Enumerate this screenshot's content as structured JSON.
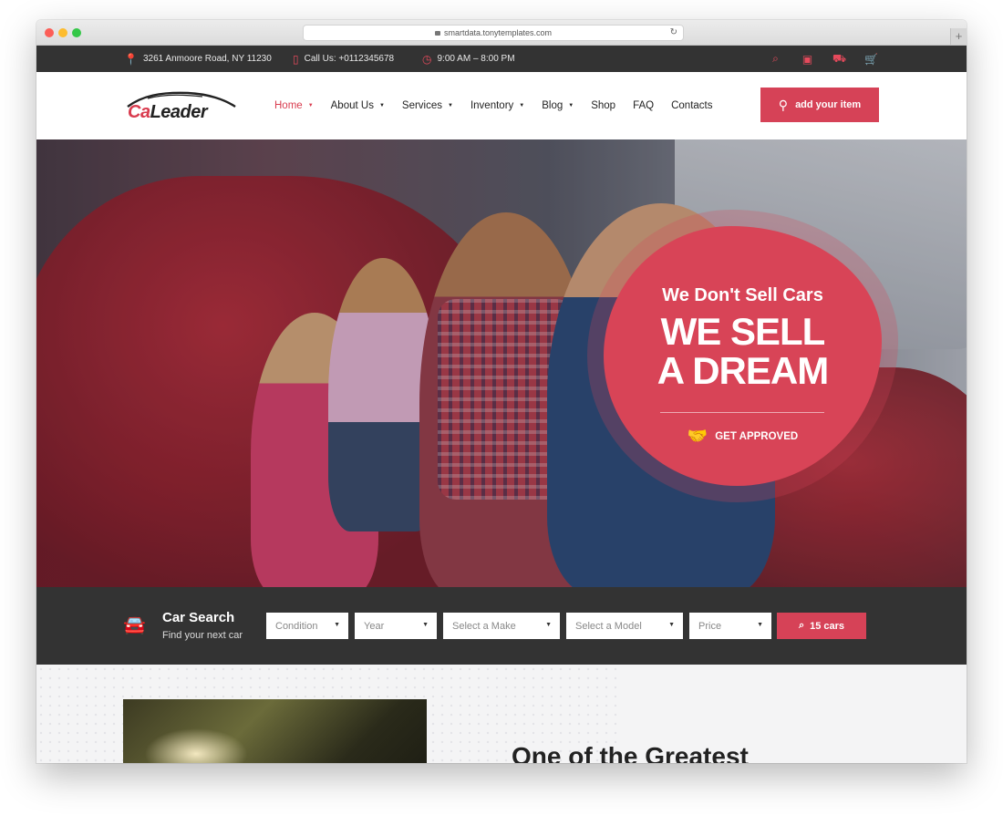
{
  "browser": {
    "url": "smartdata.tonytemplates.com",
    "newtab_symbol": "+"
  },
  "topbar": {
    "address": "3261 Anmoore Road, NY 11230",
    "phone": "Call Us: +0112345678",
    "hours": "9:00 AM – 8:00 PM",
    "icons": [
      "search-icon",
      "user-icon",
      "car-icon",
      "cart-icon"
    ]
  },
  "brand": {
    "logo_prefix": "Ca",
    "logo_suffix": "Leader",
    "accent": "#d64257"
  },
  "nav": {
    "items": [
      {
        "label": "Home",
        "dropdown": true,
        "active": true
      },
      {
        "label": "About Us",
        "dropdown": true
      },
      {
        "label": "Services",
        "dropdown": true
      },
      {
        "label": "Inventory",
        "dropdown": true
      },
      {
        "label": "Blog",
        "dropdown": true
      },
      {
        "label": "Shop",
        "dropdown": false
      },
      {
        "label": "FAQ",
        "dropdown": false
      },
      {
        "label": "Contacts",
        "dropdown": false
      }
    ],
    "cta_label": "add your item"
  },
  "hero": {
    "tagline": "We Don't Sell Cars",
    "headline_line1": "WE SELL",
    "headline_line2": "A DREAM",
    "cta_label": "GET APPROVED"
  },
  "search": {
    "title": "Car Search",
    "subtitle": "Find your next car",
    "filters": {
      "condition": "Condition",
      "year": "Year",
      "make": "Select a Make",
      "model": "Select a Model",
      "price": "Price"
    },
    "button_label": "15 cars"
  },
  "section": {
    "headline": "One of the Greatest"
  }
}
